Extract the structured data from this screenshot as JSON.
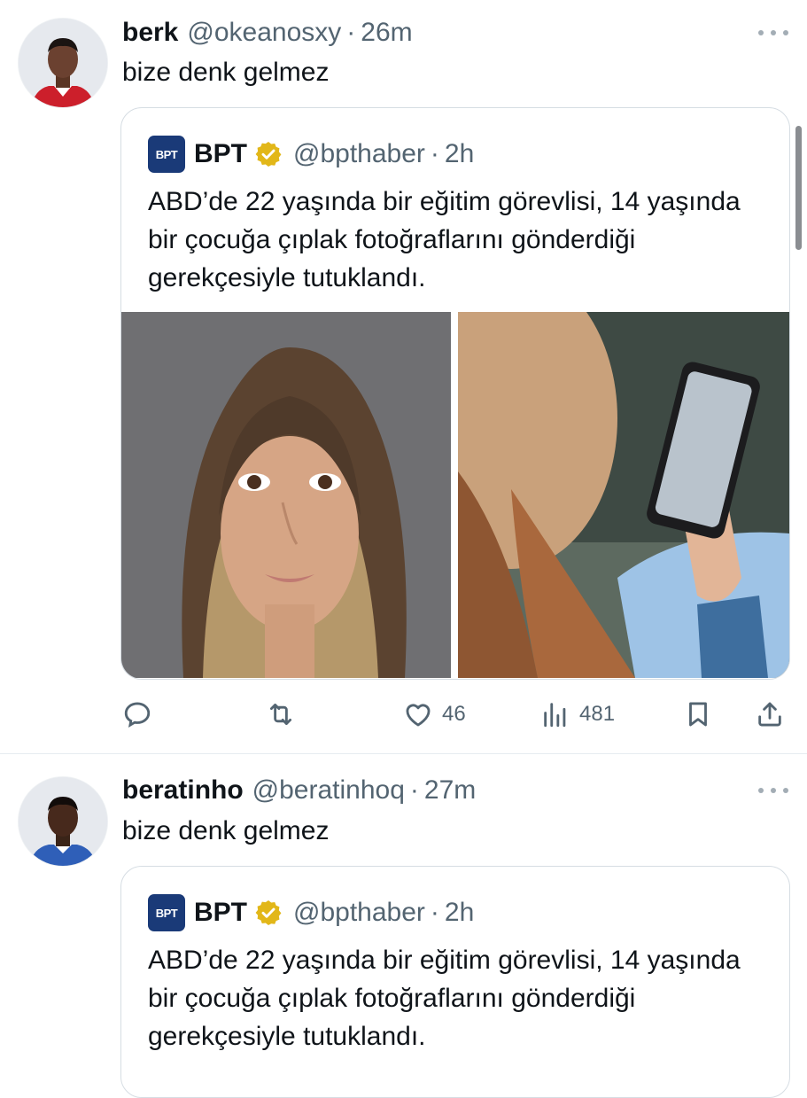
{
  "tweets": [
    {
      "author_name": "berk",
      "author_handle": "@okeanosxy",
      "separator": "·",
      "time": "26m",
      "text": "bize denk gelmez",
      "quote": {
        "logo_text": "BPT",
        "name": "BPT",
        "handle": "@bpthaber",
        "separator": "·",
        "time": "2h",
        "text": "ABD’de 22 yaşında bir eğitim görevlisi, 14 yaşında bir çocuğa çıplak fotoğraflarını gönderdiği gerekçesiyle tutuklandı."
      },
      "actions": {
        "likes": "46",
        "views": "481"
      }
    },
    {
      "author_name": "beratinho",
      "author_handle": "@beratinhoq",
      "separator": "·",
      "time": "27m",
      "text": "bize denk gelmez",
      "quote": {
        "logo_text": "BPT",
        "name": "BPT",
        "handle": "@bpthaber",
        "separator": "·",
        "time": "2h",
        "text": "ABD’de 22 yaşında bir eğitim görevlisi, 14 yaşında bir çocuğa çıplak fotoğraflarını gönderdiği gerekçesiyle tutuklandı."
      }
    }
  ],
  "icons": {
    "reply": "reply-icon",
    "retweet": "retweet-icon",
    "like": "heart-icon",
    "views": "views-icon",
    "bookmark": "bookmark-icon",
    "share": "share-icon",
    "verified": "verified-badge-icon",
    "more": "more-icon"
  },
  "colors": {
    "text": "#0f1419",
    "muted": "#536471",
    "verified_gold": "#e2b719",
    "border": "#d6dde3"
  }
}
